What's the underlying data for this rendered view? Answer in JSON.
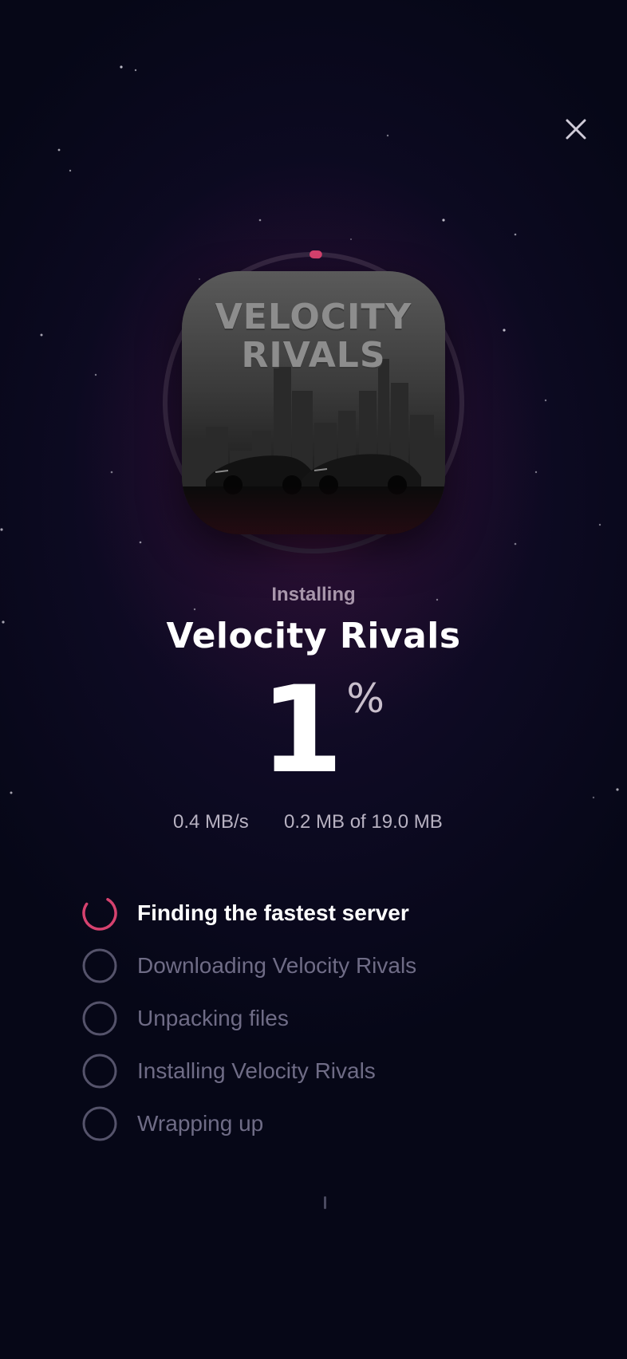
{
  "colors": {
    "accent": "#d6426f",
    "background": "#060717",
    "ring_track": "#3a2a45",
    "step_inactive": "#6f6c86",
    "text_primary": "#ffffff",
    "text_secondary": "#a896ab"
  },
  "close_icon": "close-icon",
  "game": {
    "cover_title_line1": "VELOCITY",
    "cover_title_line2": "RIVALS",
    "title": "Velocity Rivals"
  },
  "install": {
    "status_label": "Installing",
    "percent": "1",
    "percent_sign": "%",
    "progress_fraction": 0.01,
    "speed": "0.4 MB/s",
    "size_progress": "0.2 MB of 19.0 MB"
  },
  "steps": [
    {
      "label": "Finding the fastest server",
      "state": "active"
    },
    {
      "label": "Downloading Velocity Rivals",
      "state": "pending"
    },
    {
      "label": "Unpacking files",
      "state": "pending"
    },
    {
      "label": "Installing Velocity Rivals",
      "state": "pending"
    },
    {
      "label": "Wrapping up",
      "state": "pending"
    }
  ]
}
